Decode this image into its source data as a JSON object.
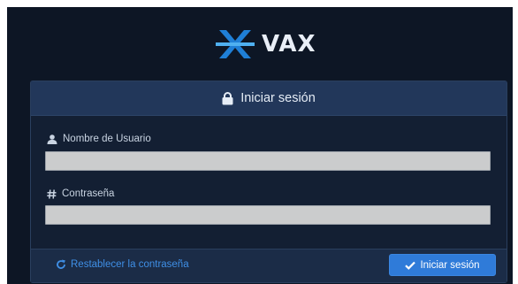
{
  "app": {
    "logo_text": "VAX",
    "brand_color": "#1f7fd6"
  },
  "login_panel": {
    "title": "Iniciar sesión",
    "title_icon": "lock-icon",
    "username": {
      "label": "Nombre de Usuario",
      "icon": "user-icon",
      "value": "",
      "placeholder": ""
    },
    "password": {
      "label": "Contraseña",
      "icon": "hash-icon",
      "value": "",
      "placeholder": ""
    },
    "reset_link": {
      "label": "Restablecer la contraseña",
      "icon": "refresh-icon"
    },
    "submit_button": {
      "label": "Iniciar sesión",
      "icon": "check-icon"
    }
  },
  "colors": {
    "background": "#0d1625",
    "panel_header": "#22375a",
    "link": "#3f8fe6",
    "button": "#2f7bd9"
  }
}
